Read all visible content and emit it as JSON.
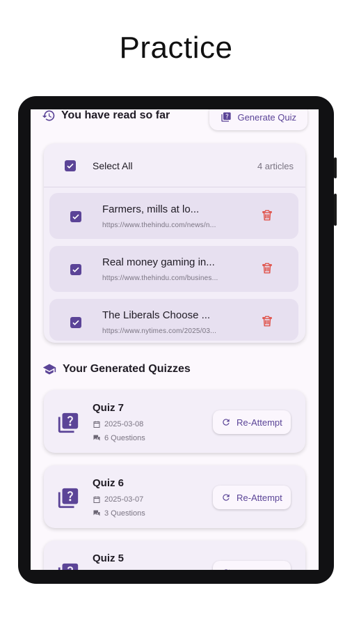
{
  "page": {
    "title": "Practice"
  },
  "read_section": {
    "title": "You have read so far",
    "generate_button": "Generate Quiz",
    "select_all_label": "Select All",
    "article_count": "4 articles",
    "articles": [
      {
        "title": "Farmers, mills at lo...",
        "url": "https://www.thehindu.com/news/n...",
        "checked": true
      },
      {
        "title": "Real money gaming in...",
        "url": "https://www.thehindu.com/busines...",
        "checked": true
      },
      {
        "title": "The Liberals Choose ...",
        "url": "https://www.nytimes.com/2025/03...",
        "checked": true
      }
    ]
  },
  "quiz_section": {
    "title": "Your Generated Quizzes",
    "action_label": "Re-Attempt",
    "quizzes": [
      {
        "title": "Quiz 7",
        "date": "2025-03-08",
        "questions": "6 Questions"
      },
      {
        "title": "Quiz 6",
        "date": "2025-03-07",
        "questions": "3 Questions"
      },
      {
        "title": "Quiz 5",
        "date": "",
        "questions": ""
      }
    ]
  },
  "colors": {
    "accent": "#5b4497",
    "delete": "#e0483e",
    "background": "#fcf8fd",
    "card": "#f3eef8"
  },
  "icons": [
    "history-icon",
    "quiz-icon",
    "checkbox-icon",
    "delete-icon",
    "graduation-cap-icon",
    "calendar-icon",
    "chat-icon",
    "refresh-icon"
  ]
}
